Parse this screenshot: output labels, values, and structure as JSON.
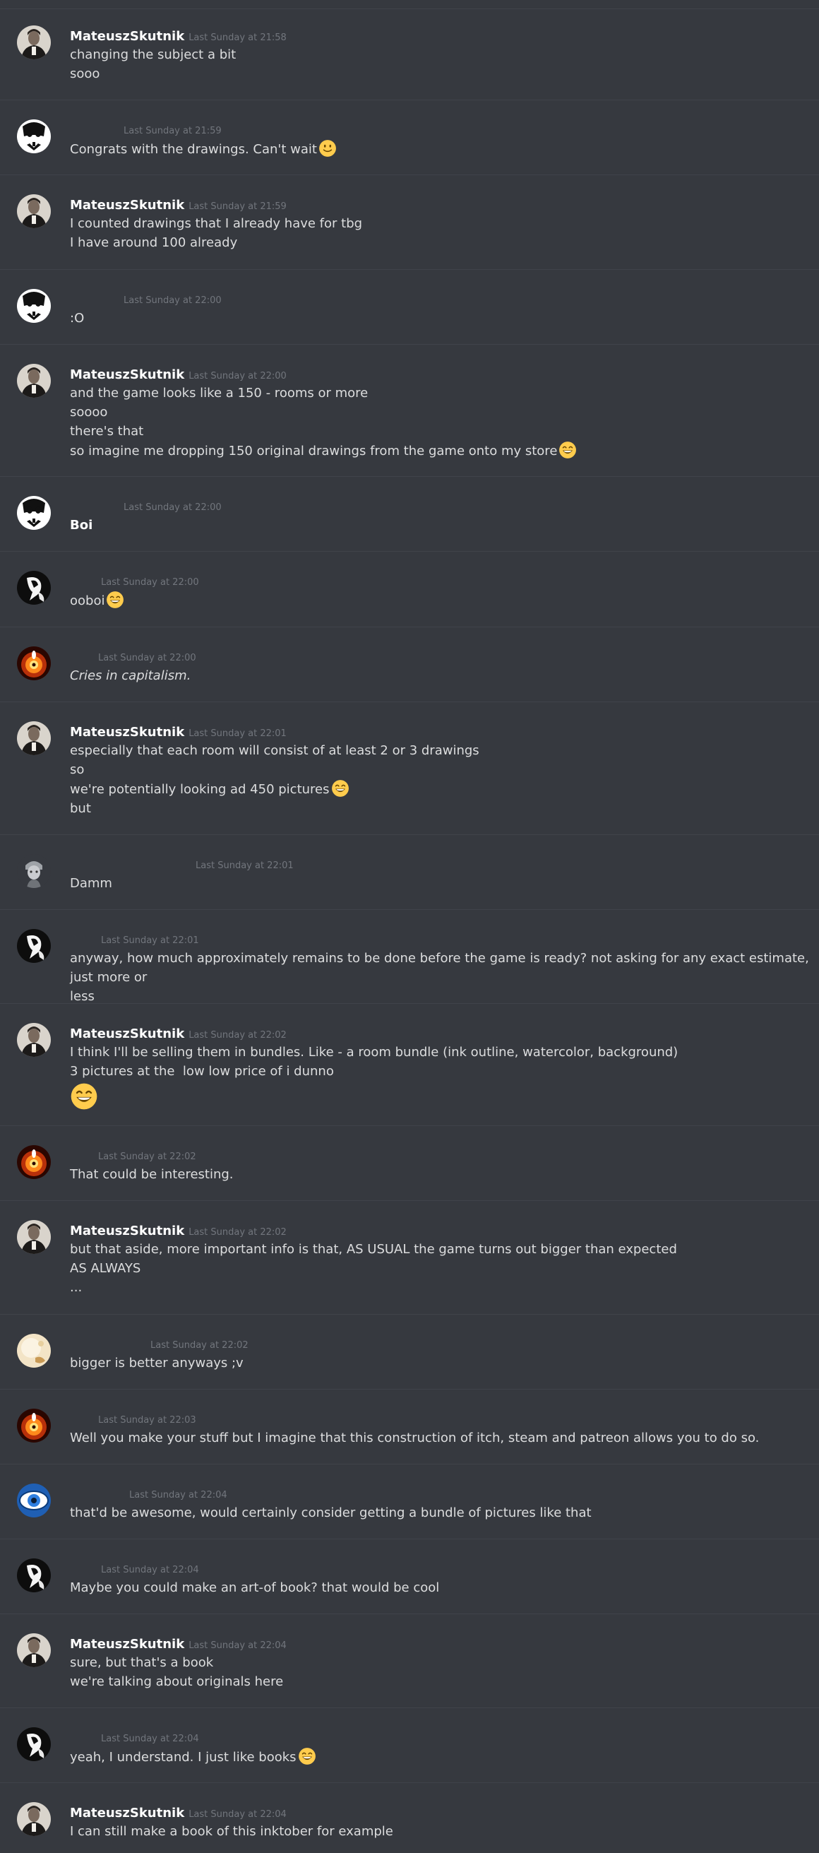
{
  "colors": {
    "background": "#36393f",
    "divider": "#40434a",
    "text": "#dcddde",
    "username": "#ffffff",
    "timestamp": "#72767d"
  },
  "messages": [
    {
      "avatar": "avatar-portrait",
      "username": "MateuszSkutnik",
      "timestamp": "Last Sunday at 21:58",
      "lines": [
        {
          "text": "changing the subject a bit"
        },
        {
          "text": "sooo"
        }
      ]
    },
    {
      "avatar": "avatar-mask",
      "username": "",
      "timestamp": "Last Sunday at 21:59",
      "lines": [
        {
          "text": "Congrats with the drawings. Can't wait",
          "emoji": "slightly-smiling-face-icon"
        }
      ]
    },
    {
      "avatar": "avatar-portrait",
      "username": "MateuszSkutnik",
      "timestamp": "Last Sunday at 21:59",
      "lines": [
        {
          "text": "I counted drawings that I already have for tbg"
        },
        {
          "text": "I have around 100 already"
        }
      ]
    },
    {
      "avatar": "avatar-mask",
      "username": "",
      "timestamp": "Last Sunday at 22:00",
      "lines": [
        {
          "text": ":O"
        }
      ]
    },
    {
      "avatar": "avatar-portrait",
      "username": "MateuszSkutnik",
      "timestamp": "Last Sunday at 22:00",
      "lines": [
        {
          "text": "and the game looks like a 150 - rooms or more"
        },
        {
          "text": "soooo"
        },
        {
          "text": "there's that"
        },
        {
          "text": "so imagine me dropping 150 original drawings from the game onto my store",
          "emoji": "grinning-face-icon"
        }
      ]
    },
    {
      "avatar": "avatar-mask",
      "username": "",
      "timestamp": "Last Sunday at 22:00",
      "lines": [
        {
          "text": "Boi",
          "style": "bold"
        }
      ]
    },
    {
      "avatar": "avatar-bw-figure",
      "username": "",
      "timestamp": "Last Sunday at 22:00",
      "lines": [
        {
          "text": "ooboi",
          "emoji": "grinning-face-icon"
        }
      ]
    },
    {
      "avatar": "avatar-fire-eye",
      "username": "",
      "timestamp": "Last Sunday at 22:00",
      "lines": [
        {
          "text": "Cries in capitalism.",
          "style": "italic"
        }
      ]
    },
    {
      "avatar": "avatar-portrait",
      "username": "MateuszSkutnik",
      "timestamp": "Last Sunday at 22:01",
      "lines": [
        {
          "text": "especially that each room will consist of at least 2 or 3 drawings"
        },
        {
          "text": "so"
        },
        {
          "text": "we're potentially looking ad 450 pictures",
          "emoji": "grinning-face-icon"
        },
        {
          "text": "but"
        }
      ]
    },
    {
      "avatar": "avatar-gray-character",
      "username": "",
      "timestamp": "Last Sunday at 22:01",
      "lines": [
        {
          "text": "Damm"
        }
      ]
    },
    {
      "avatar": "avatar-bw-figure",
      "username": "",
      "timestamp": "Last Sunday at 22:01",
      "lines": [
        {
          "text": "anyway, how much approximately remains to be done before the game is ready? not asking for any exact estimate, just more or"
        },
        {
          "text": "less"
        }
      ]
    },
    {
      "avatar": "avatar-portrait",
      "username": "MateuszSkutnik",
      "timestamp": "Last Sunday at 22:02",
      "lines": [
        {
          "text": "I think I'll be selling them in bundles. Like - a room bundle (ink outline, watercolor, background)"
        },
        {
          "text": "3 pictures at the  low low price of i dunno"
        },
        {
          "text": "",
          "emoji": "grinning-face-icon",
          "big": true
        }
      ]
    },
    {
      "avatar": "avatar-fire-eye",
      "username": "",
      "timestamp": "Last Sunday at 22:02",
      "lines": [
        {
          "text": "That could be interesting."
        }
      ]
    },
    {
      "avatar": "avatar-portrait",
      "username": "MateuszSkutnik",
      "timestamp": "Last Sunday at 22:02",
      "lines": [
        {
          "text": "but that aside, more important info is that, AS USUAL the game turns out bigger than expected"
        },
        {
          "text": "AS ALWAYS"
        },
        {
          "text": "..."
        }
      ]
    },
    {
      "avatar": "avatar-cream-circle",
      "username": "",
      "timestamp": "Last Sunday at 22:02",
      "lines": [
        {
          "text": "bigger is better anyways ;v"
        }
      ]
    },
    {
      "avatar": "avatar-fire-eye",
      "username": "",
      "timestamp": "Last Sunday at 22:03",
      "lines": [
        {
          "text": "Well you make your stuff but I imagine that this construction of itch, steam and patreon allows you to do so."
        }
      ]
    },
    {
      "avatar": "avatar-blue-eye",
      "username": "",
      "timestamp": "Last Sunday at 22:04",
      "lines": [
        {
          "text": "that'd be awesome, would certainly consider getting a bundle of pictures like that"
        }
      ]
    },
    {
      "avatar": "avatar-bw-figure",
      "username": "",
      "timestamp": "Last Sunday at 22:04",
      "lines": [
        {
          "text": "Maybe you could make an art-of book? that would be cool"
        }
      ]
    },
    {
      "avatar": "avatar-portrait",
      "username": "MateuszSkutnik",
      "timestamp": "Last Sunday at 22:04",
      "lines": [
        {
          "text": "sure, but that's a book"
        },
        {
          "text": "we're talking about originals here"
        }
      ]
    },
    {
      "avatar": "avatar-bw-figure",
      "username": "",
      "timestamp": "Last Sunday at 22:04",
      "lines": [
        {
          "text": "yeah, I understand. I just like books",
          "emoji": "grinning-face-icon"
        }
      ]
    },
    {
      "avatar": "avatar-portrait",
      "username": "MateuszSkutnik",
      "timestamp": "Last Sunday at 22:04",
      "lines": [
        {
          "text": "I can still make a book of this inktober for example"
        }
      ]
    }
  ]
}
